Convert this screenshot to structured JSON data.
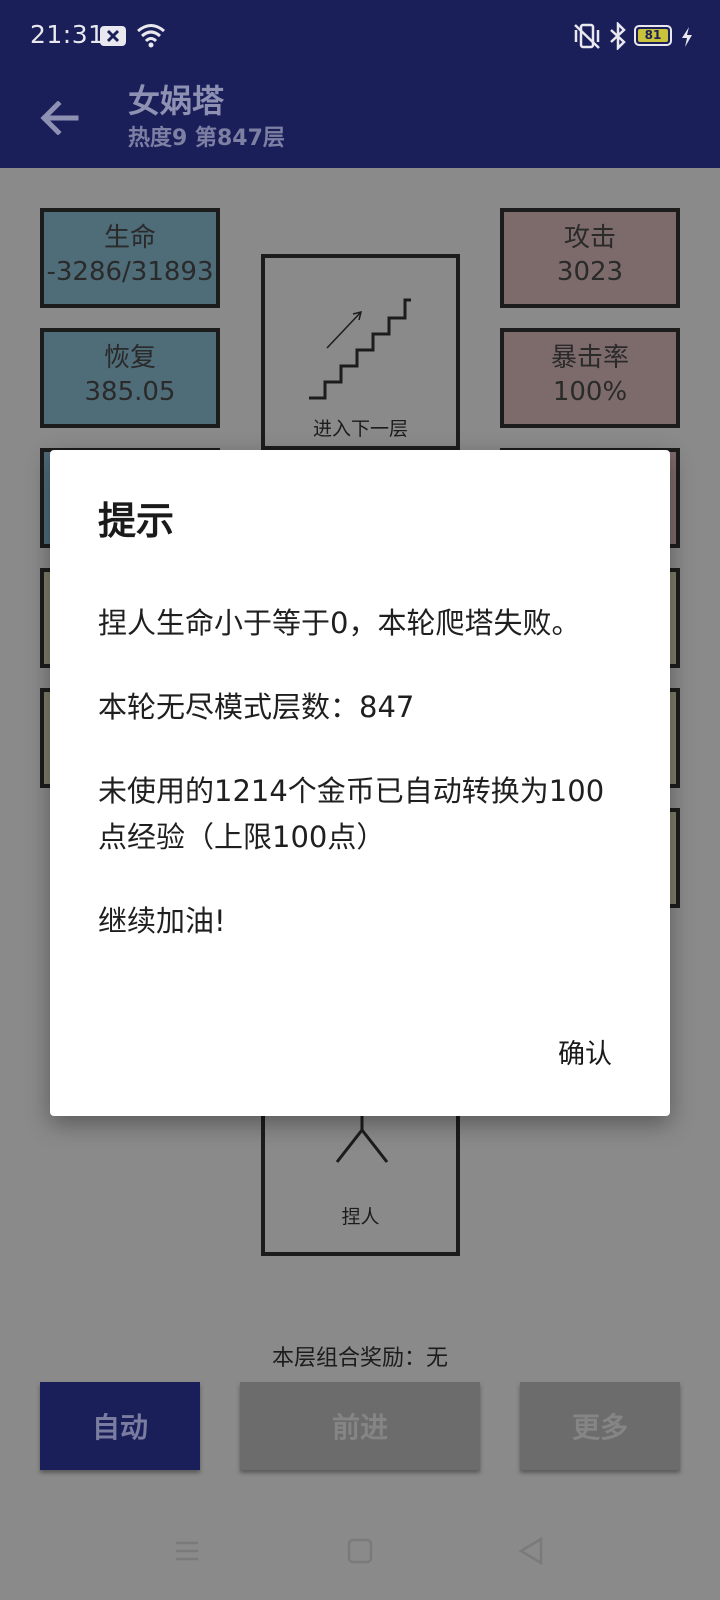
{
  "status_bar": {
    "time": "21:31",
    "battery": "81",
    "icons": [
      "notification-icon",
      "wifi-icon",
      "vibrate-icon",
      "bluetooth-icon",
      "battery-icon",
      "charging-icon"
    ]
  },
  "app_bar": {
    "title": "女娲塔",
    "subtitle": "热度9 第847层"
  },
  "stats": {
    "hp": {
      "label": "生命",
      "value": "-3286/31893"
    },
    "regen": {
      "label": "恢复",
      "value": "385.05"
    },
    "attack": {
      "label": "攻击",
      "value": "3023"
    },
    "crit": {
      "label": "暴击率",
      "value": "100%"
    }
  },
  "next_floor": {
    "label": "进入下一层"
  },
  "player": {
    "label": "捏人"
  },
  "combo_reward": "本层组合奖励：无",
  "buttons": {
    "auto": "自动",
    "forward": "前进",
    "more": "更多"
  },
  "dialog": {
    "title": "提示",
    "paragraphs": [
      "捏人生命小于等于0，本轮爬塔失败。",
      "本轮无尽模式层数：847",
      "未使用的1214个金币已自动转换为100点经验（上限100点）",
      "继续加油!"
    ],
    "confirm": "确认"
  },
  "colors": {
    "app_bar": "#1a1f5a",
    "dim_background": "#8a8a8a",
    "dialog": "#ffffff"
  }
}
